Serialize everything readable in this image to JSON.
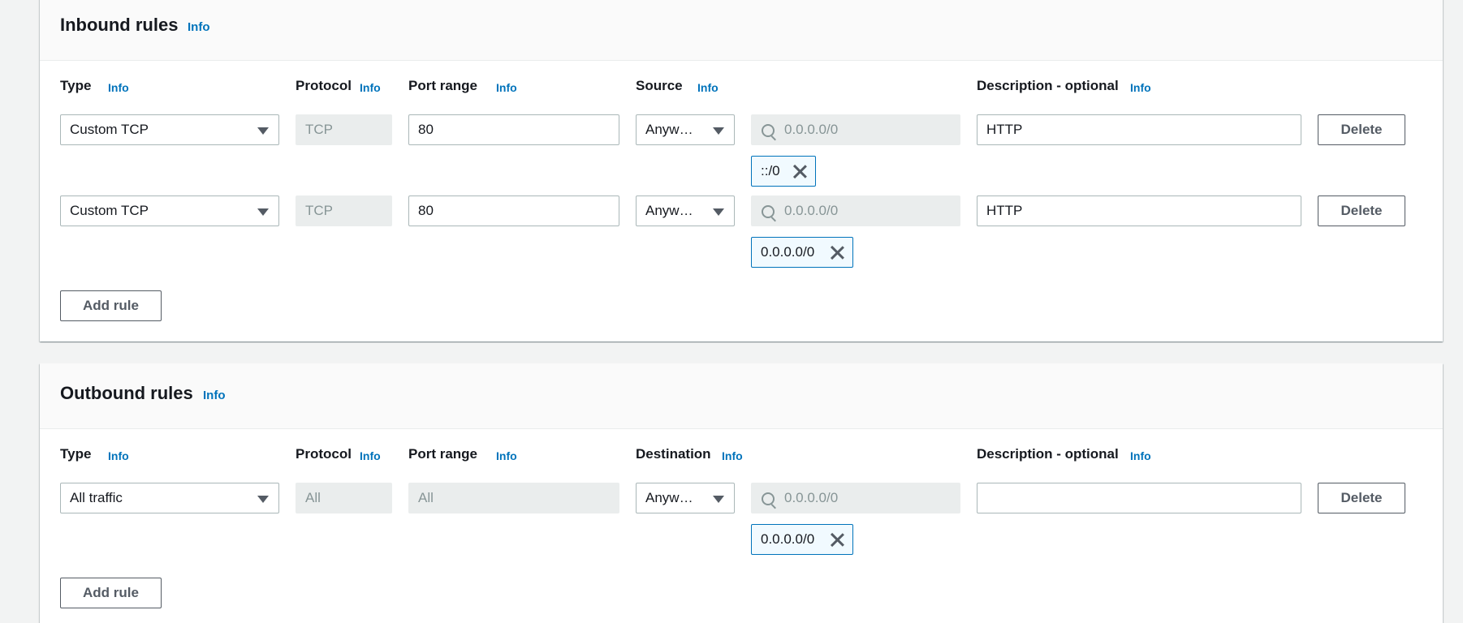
{
  "inbound": {
    "title": "Inbound rules",
    "title_info": "Info",
    "columns": {
      "type": "Type",
      "protocol": "Protocol",
      "port_range": "Port range",
      "source": "Source",
      "description": "Description - optional",
      "info": "Info"
    },
    "rules": [
      {
        "type": "Custom TCP",
        "protocol": "TCP",
        "port_range": "80",
        "source": "Anyw…",
        "cidr_placeholder": "0.0.0.0/0",
        "token": "::/0",
        "description": "HTTP",
        "delete_label": "Delete"
      },
      {
        "type": "Custom TCP",
        "protocol": "TCP",
        "port_range": "80",
        "source": "Anyw…",
        "cidr_placeholder": "0.0.0.0/0",
        "token": "0.0.0.0/0",
        "description": "HTTP",
        "delete_label": "Delete"
      }
    ],
    "add_rule_label": "Add rule"
  },
  "outbound": {
    "title": "Outbound rules",
    "title_info": "Info",
    "columns": {
      "type": "Type",
      "protocol": "Protocol",
      "port_range": "Port range",
      "destination": "Destination",
      "description": "Description - optional",
      "info": "Info"
    },
    "rules": [
      {
        "type": "All traffic",
        "protocol": "All",
        "port_range": "All",
        "destination": "Anyw…",
        "cidr_placeholder": "0.0.0.0/0",
        "token": "0.0.0.0/0",
        "description": "",
        "delete_label": "Delete"
      }
    ],
    "add_rule_label": "Add rule"
  },
  "colors": {
    "link": "#0073bb",
    "token_border": "#0073bb",
    "token_bg": "#f1faff",
    "disabled_bg": "#eaeded",
    "page_bg": "#f2f3f3"
  }
}
